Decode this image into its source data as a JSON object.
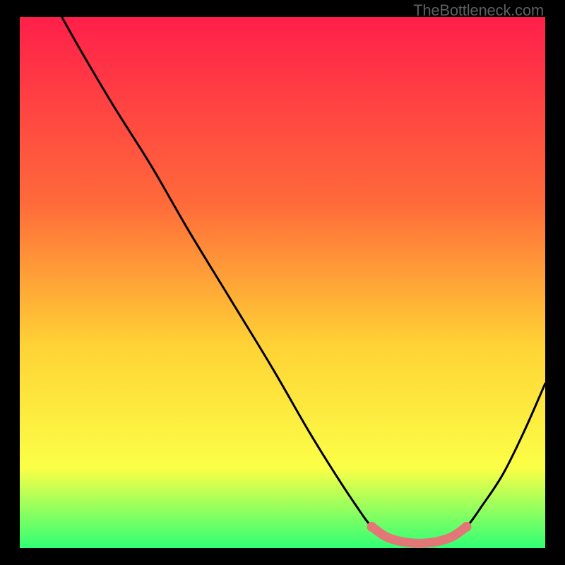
{
  "watermark": "TheBottleneck.com",
  "colors": {
    "gradient_top": "#ff1f4a",
    "gradient_mid1": "#ff6a3a",
    "gradient_mid2": "#ffd335",
    "gradient_mid3": "#fbff47",
    "gradient_bottom": "#30ff75",
    "curve": "#000000",
    "highlight": "#e37676",
    "background": "#000000"
  },
  "chart_data": {
    "type": "line",
    "title": "",
    "xlabel": "",
    "ylabel": "",
    "xlim": [
      0,
      100
    ],
    "ylim": [
      0,
      100
    ],
    "grid": false,
    "legend": false,
    "series": [
      {
        "name": "curve",
        "x": [
          8,
          12,
          18,
          25,
          32,
          40,
          48,
          55,
          60,
          64,
          67,
          70,
          74,
          78,
          82,
          85,
          88,
          92,
          96,
          100
        ],
        "values": [
          100,
          93,
          83,
          72,
          60,
          47,
          34,
          22,
          14,
          8,
          4,
          2,
          1,
          1,
          2,
          4,
          8,
          14,
          22,
          31
        ]
      },
      {
        "name": "highlight-segment",
        "x": [
          67,
          70,
          74,
          78,
          82,
          85
        ],
        "values": [
          4,
          2,
          1,
          1,
          2,
          4
        ]
      }
    ],
    "annotations": []
  }
}
